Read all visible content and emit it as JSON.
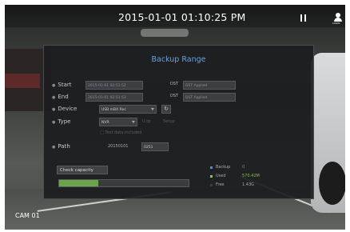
{
  "overlay": {
    "datetime": "2015-01-01 01:10:25 PM",
    "camera_label": "CAM 01",
    "user_label": "LOGIN"
  },
  "dialog": {
    "title": "Backup Range",
    "start": {
      "label": "Start",
      "value": "2015-01-01 02:51:52",
      "dst_label": "DST",
      "dst_value": "DST Applied"
    },
    "end": {
      "label": "End",
      "value": "2015-01-01 02:51:53",
      "dst_label": "DST",
      "dst_value": "DST Applied"
    },
    "device": {
      "label": "Device",
      "value": "USB mBX Rec",
      "refresh_icon": "refresh-icon"
    },
    "type": {
      "label": "Type",
      "value": "NVR",
      "option1": "U.tp",
      "option2": "Setup",
      "checkbox_label": "Text data Included"
    },
    "path": {
      "label": "Path",
      "folder": "20150101",
      "file": "0251"
    },
    "check_capacity_label": "Check capacity",
    "progress": 0.3,
    "legend": [
      {
        "key": "Backup",
        "value": "0",
        "color": "#4a8fd8"
      },
      {
        "key": "Used",
        "value": "570.42M",
        "color": "#8cc63f"
      },
      {
        "key": "Free",
        "value": "1.43G",
        "color": "#3a3c40"
      }
    ]
  }
}
